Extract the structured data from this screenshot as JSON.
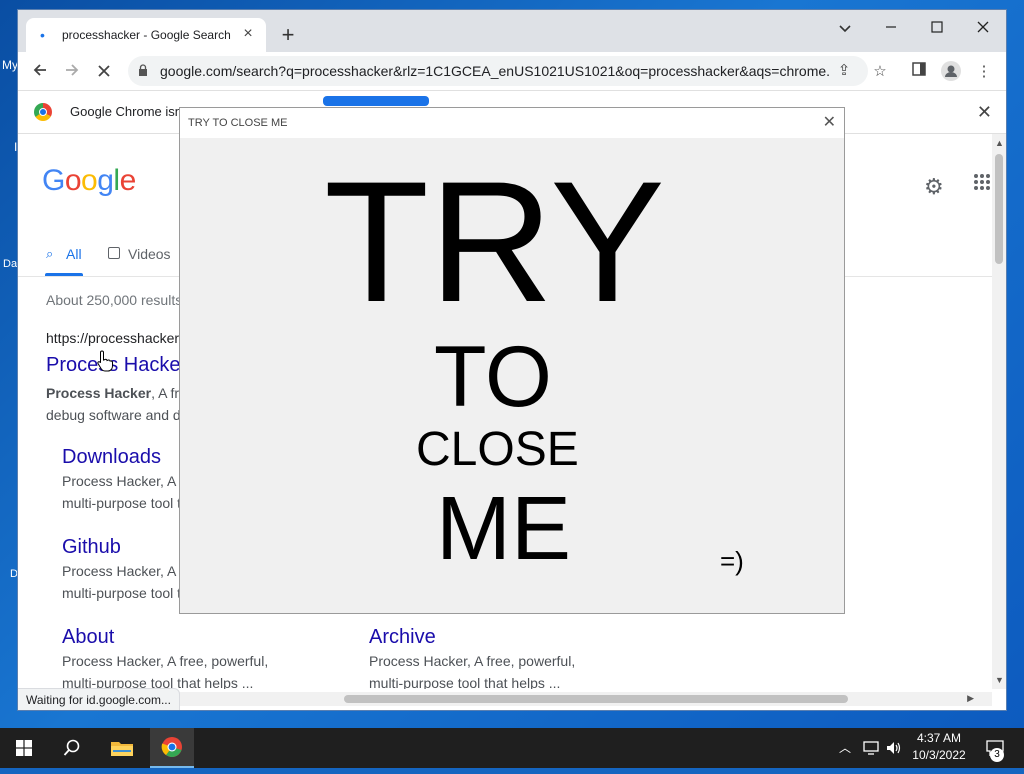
{
  "desktop": {
    "frag_my": "My",
    "frag_i": "I",
    "frag_da": "Da",
    "frag_d": "D"
  },
  "browser": {
    "tab_title": "processhacker - Google Search",
    "url": "google.com/search?q=processhacker&rlz=1C1GCEA_enUS1021US1021&oq=processhacker&aqs=chrome....",
    "infobar_text": "Google Chrome isn",
    "status_text": "Waiting for id.google.com..."
  },
  "google": {
    "logo": "Google",
    "tabs": [
      {
        "label": "All"
      },
      {
        "label": "Videos"
      }
    ],
    "result_count": "About 250,000 results",
    "cite": "https://processhacker",
    "main_result": {
      "title": "Process Hacke",
      "snippet_bold": "Process Hacker",
      "snippet_rest": ", A fr",
      "snippet_line2": "debug software and d"
    },
    "sitelinks": [
      {
        "title": "Downloads",
        "line1": "Process Hacker, A",
        "line2": "multi-purpose tool t"
      },
      {
        "title": "Github",
        "line1": "Process Hacker, A",
        "line2": "multi-purpose tool t"
      },
      {
        "title": "About",
        "line1": "Process Hacker, A free, powerful,",
        "line2": "multi-purpose tool that helps ..."
      },
      {
        "title": "Archive",
        "line1": "Process Hacker, A free, powerful,",
        "line2": "multi-purpose tool that helps ..."
      }
    ]
  },
  "popup": {
    "title": "TRY TO CLOSE ME",
    "words": [
      "TRY",
      "TO",
      "CLOSE",
      "ME"
    ],
    "smiley": "=)"
  },
  "taskbar": {
    "time": "4:37 AM",
    "date": "10/3/2022",
    "notification_count": "3"
  },
  "colors": {
    "accent": "#1a73e8",
    "link": "#1a0dab",
    "taskbar": "#1f1f1f"
  },
  "icons": [
    "windows-start-icon",
    "search-icon",
    "file-explorer-icon",
    "chrome-icon",
    "gear-icon",
    "apps-grid-icon",
    "lock-icon",
    "share-icon",
    "star-icon",
    "side-panel-icon",
    "profile-icon",
    "menu-icon"
  ]
}
